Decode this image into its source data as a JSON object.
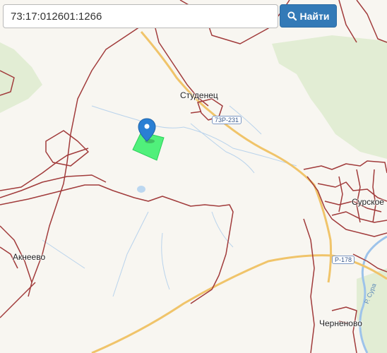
{
  "search": {
    "value": "73:17:012601:1266",
    "button_label": "Найти",
    "button_icon": "search-icon"
  },
  "map": {
    "places": {
      "studenets": "Студенец",
      "akneevo": "Акнеево",
      "surskoe": "Сурское",
      "chernenovo": "Черненово"
    },
    "roads": {
      "r73_231": "73Р-231",
      "r178": "Р-178"
    },
    "river": "Р. Сура",
    "colors": {
      "parcel_boundary": "#a13b3b",
      "selected_parcel": "#33ee66",
      "marker": "#2a7fd4",
      "forest": "#e1ecd3",
      "background": "#f8f6f1",
      "main_road": "#f1c66a",
      "water": "#aacbec"
    },
    "marker_icon": "map-marker-icon"
  }
}
